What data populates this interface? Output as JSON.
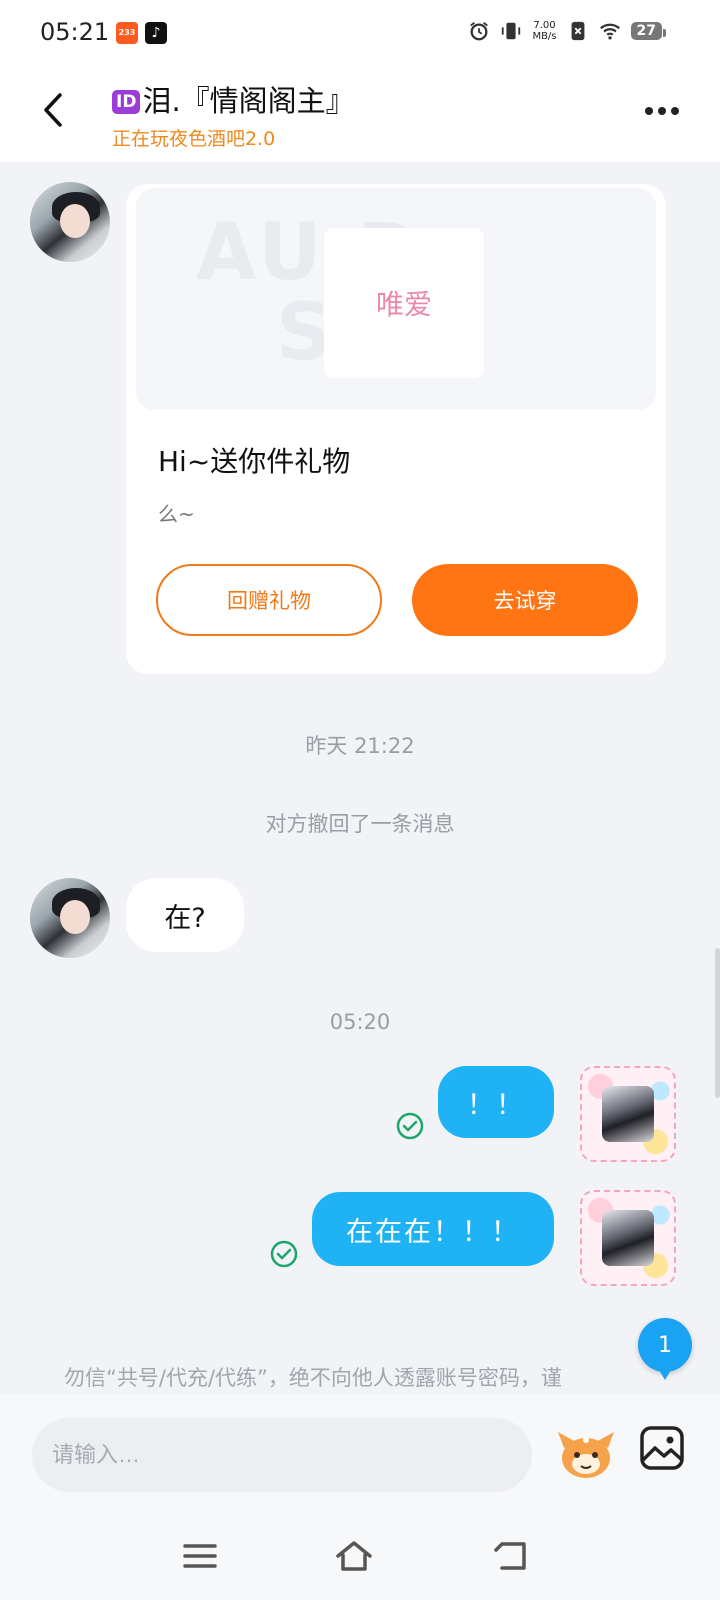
{
  "status_bar": {
    "time": "05:21",
    "app_badge_1": "233",
    "net_speed_value": "7.00",
    "net_speed_unit": "MB/s",
    "battery": "27"
  },
  "header": {
    "id_badge": "ID",
    "title": "泪.『情阁阁主』",
    "subtitle": "正在玩夜色酒吧2.0"
  },
  "gift_card": {
    "image_logo": "唯爱",
    "title": "Hi~送你件礼物",
    "subtitle": "么~",
    "return_gift_label": "回赠礼物",
    "try_on_label": "去试穿"
  },
  "messages": {
    "timestamp_1": "昨天 21:22",
    "recalled_notice": "对方撤回了一条消息",
    "incoming_1": "在?",
    "timestamp_2": "05:20",
    "outgoing_1": "！！",
    "outgoing_2": "在在在！！！"
  },
  "unread_count": "1",
  "safety_notice": "勿信“共号/代充/代练”，绝不向他人透露账号密码，谨",
  "input": {
    "placeholder": "请输入…"
  },
  "colors": {
    "accent_orange": "#ff7514",
    "subtitle_orange": "#ef8a1f",
    "bubble_blue": "#1fb3f5",
    "check_green": "#1aa86a",
    "id_purple": "#9b3bd8"
  }
}
